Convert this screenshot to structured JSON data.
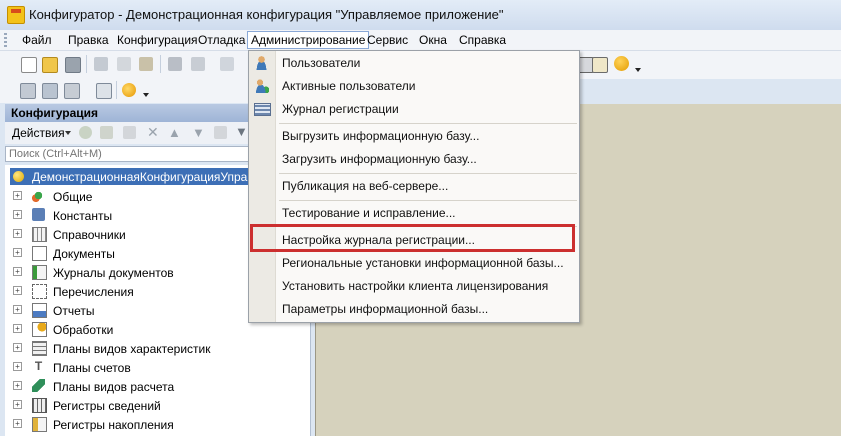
{
  "window": {
    "title": "Конфигуратор - Демонстрационная конфигурация \"Управляемое приложение\""
  },
  "menubar": {
    "items": [
      {
        "label": "Файл"
      },
      {
        "label": "Правка"
      },
      {
        "label": "Конфигурация"
      },
      {
        "label": "Отладка"
      },
      {
        "label": "Администрирование"
      },
      {
        "label": "Сервис"
      },
      {
        "label": "Окна"
      },
      {
        "label": "Справка"
      }
    ],
    "active_index": 4
  },
  "panel": {
    "title": "Конфигурация",
    "actions_label": "Действия",
    "search_placeholder": "Поиск (Ctrl+Alt+M)"
  },
  "tree": {
    "root_label": "ДемонстрационнаяКонфигурацияУправляемоеПриложение",
    "items": [
      {
        "label": "Общие",
        "icon": "common-icon"
      },
      {
        "label": "Константы",
        "icon": "constants-icon"
      },
      {
        "label": "Справочники",
        "icon": "catalogs-icon"
      },
      {
        "label": "Документы",
        "icon": "documents-icon"
      },
      {
        "label": "Журналы документов",
        "icon": "document-journals-icon"
      },
      {
        "label": "Перечисления",
        "icon": "enums-icon"
      },
      {
        "label": "Отчеты",
        "icon": "reports-icon"
      },
      {
        "label": "Обработки",
        "icon": "data-processors-icon"
      },
      {
        "label": "Планы видов характеристик",
        "icon": "chart-of-characteristic-types-icon"
      },
      {
        "label": "Планы счетов",
        "icon": "chart-of-accounts-icon"
      },
      {
        "label": "Планы видов расчета",
        "icon": "chart-of-calculation-types-icon"
      },
      {
        "label": "Регистры сведений",
        "icon": "information-registers-icon"
      },
      {
        "label": "Регистры накопления",
        "icon": "accumulation-registers-icon"
      }
    ]
  },
  "dropdown": {
    "items": [
      {
        "label": "Пользователи",
        "icon": "user-icon"
      },
      {
        "label": "Активные пользователи",
        "icon": "active-users-icon"
      },
      {
        "label": "Журнал регистрации",
        "icon": "event-log-icon"
      },
      {
        "label": "Выгрузить информационную базу..."
      },
      {
        "label": "Загрузить информационную базу..."
      },
      {
        "label": "Публикация на веб-сервере..."
      },
      {
        "label": "Тестирование и исправление..."
      },
      {
        "label": "Настройка журнала регистрации..."
      },
      {
        "label": "Региональные установки информационной базы..."
      },
      {
        "label": "Установить настройки клиента лицензирования"
      },
      {
        "label": "Параметры информационной базы..."
      }
    ],
    "highlighted_label": "Настройка журнала регистрации...",
    "highlight_color": "#cc2f2f"
  },
  "colors": {
    "selection": "#3d6fb6",
    "workspace": "#d6d2bd",
    "menu_background": "#faf9f7"
  }
}
